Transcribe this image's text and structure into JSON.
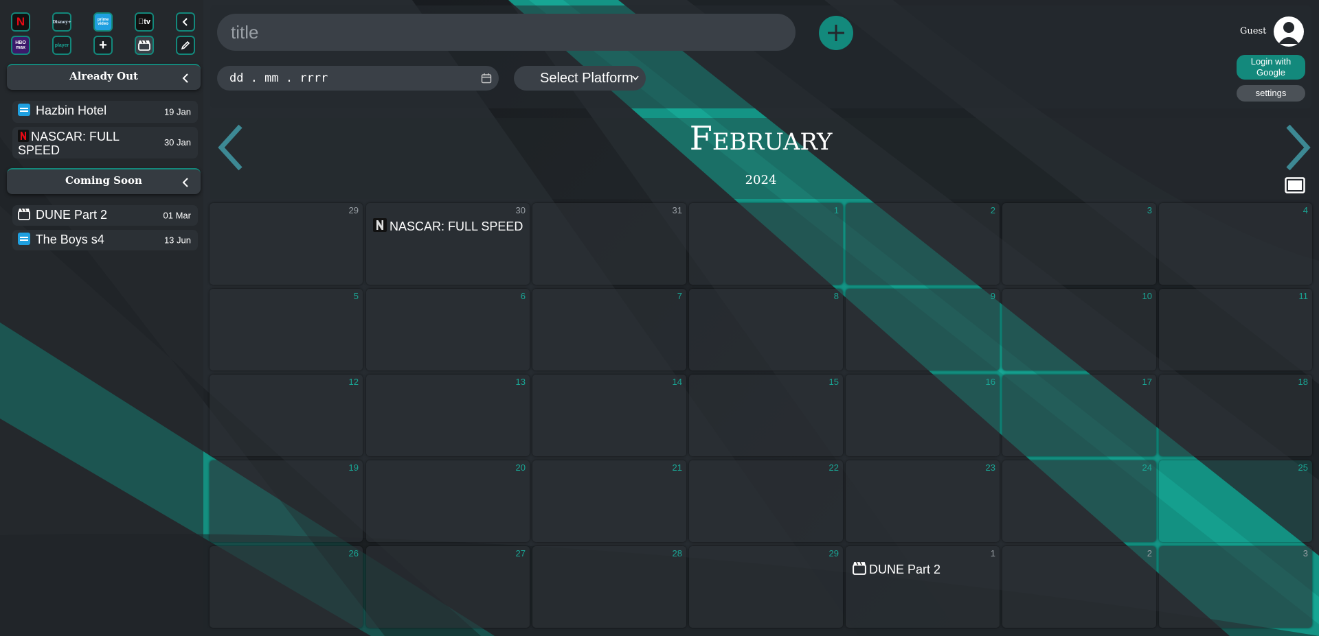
{
  "platforms": [
    {
      "id": "netflix",
      "label": "N"
    },
    {
      "id": "disney",
      "label": "Disney+"
    },
    {
      "id": "prime",
      "label": "prime video"
    },
    {
      "id": "appletv",
      "label": "tv"
    },
    {
      "id": "hbomax",
      "label": "HBO max"
    },
    {
      "id": "player",
      "label": "player"
    },
    {
      "id": "add",
      "label": "+"
    },
    {
      "id": "cinema",
      "label": ""
    }
  ],
  "sidebar": {
    "already_out": {
      "title": "Already Out",
      "items": [
        {
          "title": "Hazbin Hotel",
          "date": "19 Jan",
          "icon": "prime-video-icon"
        },
        {
          "title": "NASCAR: FULL SPEED",
          "date": "30 Jan",
          "icon": "netflix-icon"
        }
      ]
    },
    "coming_soon": {
      "title": "Coming Soon",
      "items": [
        {
          "title": "DUNE Part 2",
          "date": "01 Mar",
          "icon": "cinema-icon"
        },
        {
          "title": "The Boys s4",
          "date": "13 Jun",
          "icon": "prime-video-icon"
        }
      ]
    }
  },
  "header": {
    "title_placeholder": "title",
    "date_placeholder": "dd . mm . rrrr",
    "platform_select": "Select Platform",
    "user": "Guest",
    "login_label": "Login with Google",
    "settings_label": "settings"
  },
  "calendar": {
    "month": "February",
    "year": "2024",
    "days": [
      "29",
      "30",
      "31",
      "1",
      "2",
      "3",
      "4",
      "5",
      "6",
      "7",
      "8",
      "9",
      "10",
      "11",
      "12",
      "13",
      "14",
      "15",
      "16",
      "17",
      "18",
      "19",
      "20",
      "21",
      "22",
      "23",
      "24",
      "25",
      "26",
      "27",
      "28",
      "29",
      "1",
      "2",
      "3"
    ],
    "events": [
      {
        "day_index": 1,
        "title": "NASCAR: FULL SPEED",
        "icon": "netflix-icon"
      },
      {
        "day_index": 32,
        "title": "DUNE Part 2",
        "icon": "cinema-icon"
      }
    ],
    "today_index": 27
  },
  "colors": {
    "accent": "#13897c",
    "background": "#23272c",
    "cell": "#2b3035"
  }
}
